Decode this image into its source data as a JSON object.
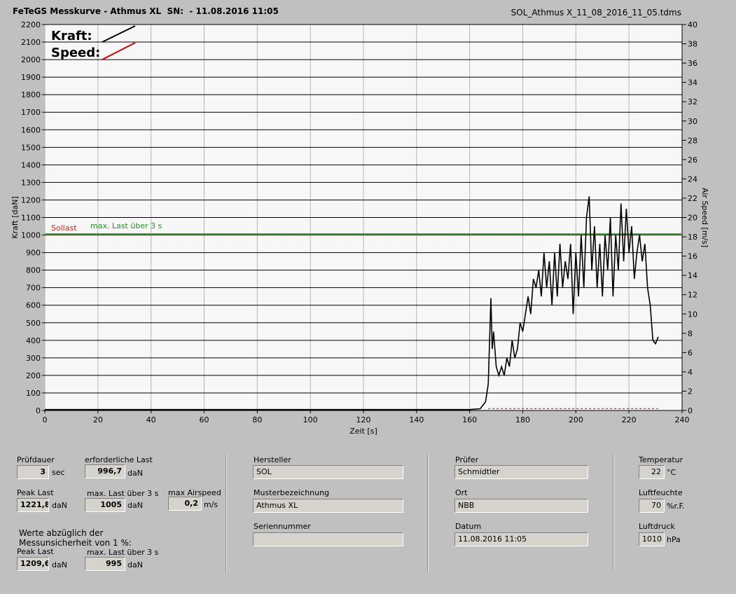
{
  "header": {
    "title": "FeTeGS Messkurve - Athmus XL  SN:  - 11.08.2016 11:05",
    "filename": "SOL_Athmus X_11_08_2016_11_05.tdms"
  },
  "chart_data": {
    "type": "line",
    "xlabel": "Zeit [s]",
    "ylabel": "Kraft [daN]",
    "y2label": "Air Speed [m/s]",
    "xlim": [
      0,
      240
    ],
    "ylim": [
      0,
      2200
    ],
    "y2lim": [
      0,
      40
    ],
    "xticks": [
      0,
      20,
      40,
      60,
      80,
      100,
      120,
      140,
      160,
      180,
      200,
      220,
      240
    ],
    "yticks": [
      0,
      100,
      200,
      300,
      400,
      500,
      600,
      700,
      800,
      900,
      1000,
      1100,
      1200,
      1300,
      1400,
      1500,
      1600,
      1700,
      1800,
      1900,
      2000,
      2100,
      2200
    ],
    "y2ticks": [
      0,
      2,
      4,
      6,
      8,
      10,
      12,
      14,
      16,
      18,
      20,
      22,
      24,
      26,
      28,
      30,
      32,
      34,
      36,
      38,
      40
    ],
    "legend": [
      {
        "name": "Kraft:",
        "color": "#000000"
      },
      {
        "name": "Speed:",
        "color": "#cc0000"
      }
    ],
    "reference_lines": [
      {
        "name": "Sollast",
        "y": 1000,
        "color": "#cc2222"
      },
      {
        "name": "max. Last über  3 s",
        "y": 1005,
        "color": "#2e8b2e"
      }
    ],
    "series": [
      {
        "name": "Kraft",
        "color": "#000000",
        "x": [
          0,
          20,
          40,
          60,
          80,
          100,
          120,
          140,
          160,
          164,
          165,
          166,
          167,
          168,
          168.5,
          169,
          170,
          171,
          172,
          173,
          174,
          175,
          176,
          177,
          178,
          179,
          180,
          181,
          182,
          183,
          184,
          185,
          186,
          187,
          188,
          189,
          190,
          191,
          192,
          193,
          194,
          195,
          196,
          197,
          198,
          199,
          200,
          201,
          202,
          203,
          204,
          205,
          206,
          207,
          208,
          209,
          210,
          211,
          212,
          213,
          214,
          215,
          216,
          217,
          218,
          219,
          220,
          221,
          222,
          223,
          224,
          225,
          226,
          227,
          228,
          229,
          230,
          231
        ],
        "y": [
          5,
          5,
          5,
          5,
          5,
          5,
          5,
          5,
          5,
          10,
          30,
          50,
          150,
          640,
          350,
          450,
          250,
          200,
          250,
          200,
          300,
          250,
          400,
          300,
          350,
          500,
          450,
          550,
          650,
          550,
          750,
          700,
          800,
          650,
          900,
          700,
          850,
          600,
          900,
          650,
          950,
          700,
          850,
          750,
          950,
          550,
          900,
          650,
          1000,
          700,
          1100,
          1220,
          800,
          1050,
          700,
          950,
          650,
          1000,
          800,
          1100,
          650,
          1000,
          800,
          1180,
          850,
          1150,
          900,
          1050,
          750,
          900,
          1000,
          850,
          950,
          700,
          600,
          400,
          380,
          420
        ]
      },
      {
        "name": "Speed",
        "color": "#cc0000",
        "x": [
          167,
          231
        ],
        "y": [
          0.2,
          0.2
        ]
      }
    ]
  },
  "panel": {
    "pruefdauer_label": "Prüfdauer",
    "pruefdauer_value": "3",
    "pruefdauer_unit": "sec",
    "erf_last_label": "erforderliche Last",
    "erf_last_value": "996,7",
    "erf_last_unit": "daN",
    "peak_last_label": "Peak Last",
    "peak_last_value": "1221,8",
    "peak_last_unit": "daN",
    "max_last_label": "max. Last über  3 s",
    "max_last_value": "1005",
    "max_last_unit": "daN",
    "max_airspeed_label": "max Airspeed",
    "max_airspeed_value": "0,2",
    "max_airspeed_unit": "m/s",
    "werte_line1": "Werte abzüglich der",
    "werte_line2": "Messunsicherheit von 1  %:",
    "peak_last2_label": "Peak Last",
    "peak_last2_value": "1209,6",
    "peak_last2_unit": "daN",
    "max_last2_label": "max. Last über  3 s",
    "max_last2_value": "995",
    "max_last2_unit": "daN",
    "hersteller_label": "Hersteller",
    "hersteller_value": "SOL",
    "muster_label": "Musterbezeichnung",
    "muster_value": "Athmus XL",
    "serien_label": "Seriennummer",
    "serien_value": "",
    "pruefer_label": "Prüfer",
    "pruefer_value": "Schmidtler",
    "ort_label": "Ort",
    "ort_value": "NBB",
    "datum_label": "Datum",
    "datum_value": "11.08.2016 11:05",
    "temp_label": "Temperatur",
    "temp_value": "22",
    "temp_unit": "°C",
    "feuchte_label": "Luftfeuchte",
    "feuchte_value": "70",
    "feuchte_unit": "%r.F.",
    "druck_label": "Luftdruck",
    "druck_value": "1010",
    "druck_unit": "hPa"
  }
}
